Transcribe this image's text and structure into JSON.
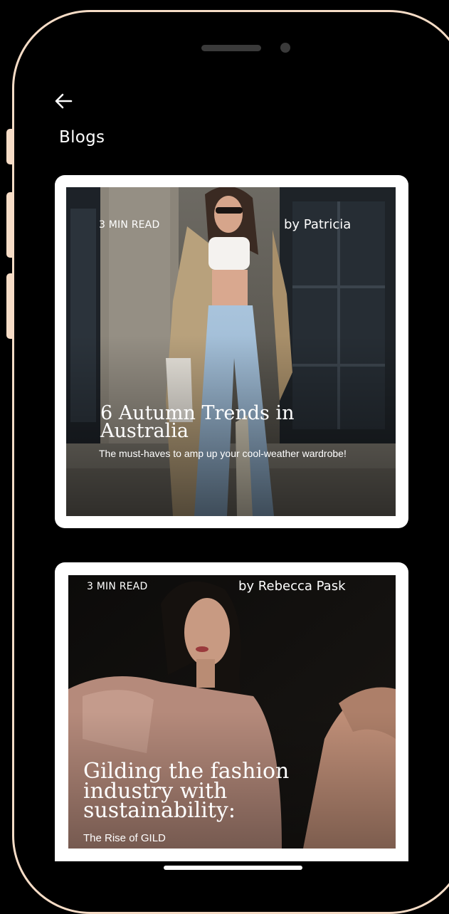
{
  "header": {
    "back_label": "←",
    "title": "Blogs"
  },
  "blogs": [
    {
      "read_time": "3 MIN READ",
      "author": "by Patricia",
      "title": "6 Autumn Trends in Australia",
      "subtitle": "The must-haves to amp up your cool-weather wardrobe!"
    },
    {
      "read_time": "3 MIN READ",
      "author": "by Rebecca Pask",
      "title": "Gilding the fashion industry with sustainability:",
      "subtitle": "The Rise of GILD"
    }
  ],
  "icons": {
    "back": "arrow-left-icon",
    "speaker": "speaker-slot",
    "camera": "front-camera-dot"
  },
  "colors": {
    "frame": "#f6dcc6",
    "background": "#000000",
    "card": "#ffffff",
    "text": "#ffffff"
  }
}
